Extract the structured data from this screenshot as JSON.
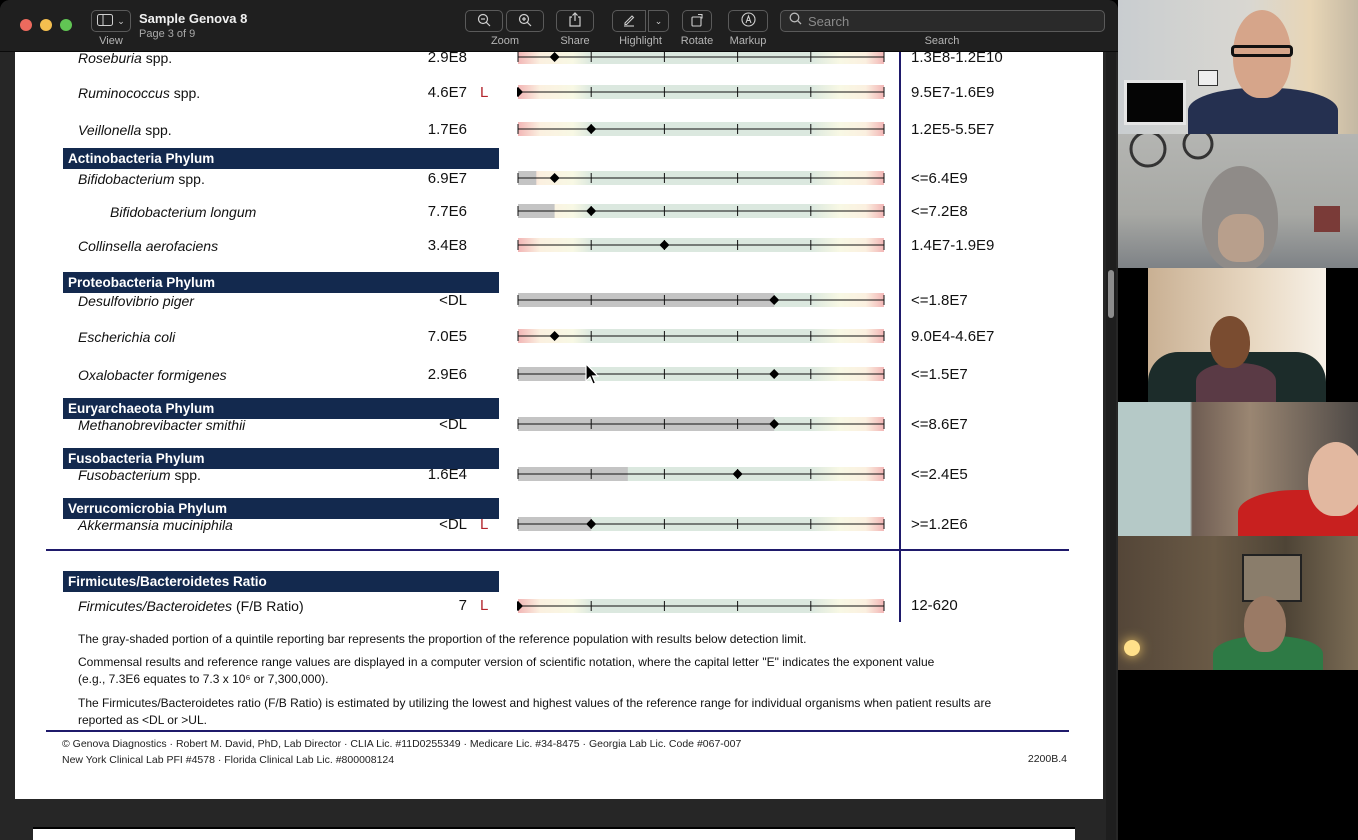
{
  "app": {
    "title": "Sample Genova 8",
    "subtitle": "Page 3 of 9"
  },
  "toolbar": {
    "view_label": "View",
    "zoom_label": "Zoom",
    "share_label": "Share",
    "highlight_label": "Highlight",
    "rotate_label": "Rotate",
    "markup_label": "Markup",
    "search_label": "Search",
    "search_placeholder": "Search"
  },
  "report": {
    "rows": [
      {
        "type": "organism",
        "genus": "Roseburia",
        "suffix": " spp.",
        "result": "2.9E8",
        "flag": "",
        "ref": "1.3E8-1.2E10",
        "marker_quintile": 0.5,
        "gray_fraction": 0
      },
      {
        "type": "organism",
        "genus": "Ruminococcus",
        "suffix": " spp.",
        "result": "4.6E7",
        "flag": "L",
        "ref": "9.5E7-1.6E9",
        "marker_quintile": 0,
        "gray_fraction": 0
      },
      {
        "type": "organism",
        "genus": "Veillonella",
        "suffix": " spp.",
        "result": "1.7E6",
        "flag": "",
        "ref": "1.2E5-5.5E7",
        "marker_quintile": 1,
        "gray_fraction": 0
      },
      {
        "type": "phylum",
        "label": "Actinobacteria Phylum"
      },
      {
        "type": "organism",
        "genus": "Bifidobacterium",
        "suffix": " spp.",
        "result": "6.9E7",
        "flag": "",
        "ref": "<=6.4E9",
        "marker_quintile": 0.5,
        "gray_fraction": 0.05
      },
      {
        "type": "organism",
        "genus": "Bifidobacterium longum",
        "suffix": "",
        "indent": true,
        "result": "7.7E6",
        "flag": "",
        "ref": "<=7.2E8",
        "marker_quintile": 1,
        "gray_fraction": 0.1
      },
      {
        "type": "organism",
        "genus": "Collinsella aerofaciens",
        "suffix": "",
        "result": "3.4E8",
        "flag": "",
        "ref": "1.4E7-1.9E9",
        "marker_quintile": 2,
        "gray_fraction": 0
      },
      {
        "type": "phylum",
        "label": "Proteobacteria Phylum"
      },
      {
        "type": "organism",
        "genus": "Desulfovibrio piger",
        "suffix": "",
        "result": "<DL",
        "flag": "",
        "ref": "<=1.8E7",
        "marker_quintile": 3.5,
        "gray_fraction": 0.7
      },
      {
        "type": "organism",
        "genus": "Escherichia coli",
        "suffix": "",
        "result": "7.0E5",
        "flag": "",
        "ref": "9.0E4-4.6E7",
        "marker_quintile": 0.5,
        "gray_fraction": 0
      },
      {
        "type": "organism",
        "genus": "Oxalobacter formigenes",
        "suffix": "",
        "result": "2.9E6",
        "flag": "",
        "ref": "<=1.5E7",
        "marker_quintile": 3.5,
        "gray_fraction": 0.19
      },
      {
        "type": "phylum",
        "label": "Euryarchaeota Phylum"
      },
      {
        "type": "organism",
        "genus": "Methanobrevibacter smithii",
        "suffix": "",
        "result": "<DL",
        "flag": "",
        "ref": "<=8.6E7",
        "marker_quintile": 3.5,
        "gray_fraction": 0.7
      },
      {
        "type": "phylum",
        "label": "Fusobacteria Phylum"
      },
      {
        "type": "organism",
        "genus": "Fusobacterium",
        "suffix": " spp.",
        "result": "1.6E4",
        "flag": "",
        "ref": "<=2.4E5",
        "marker_quintile": 3,
        "gray_fraction": 0.3
      },
      {
        "type": "phylum",
        "label": "Verrucomicrobia Phylum"
      },
      {
        "type": "organism",
        "genus": "Akkermansia muciniphila",
        "suffix": "",
        "result": "<DL",
        "flag": "L",
        "ref": ">=1.2E6",
        "marker_quintile": 1,
        "gray_fraction": 0.2
      }
    ],
    "ratio_section": {
      "header": "Firmicutes/Bacteroidetes Ratio",
      "genus": "Firmicutes/Bacteroidetes",
      "suffix": " (F/B Ratio)",
      "result": "7",
      "flag": "L",
      "ref": "12-620",
      "marker_quintile": 0
    },
    "notes": [
      "The gray-shaded portion of a quintile reporting bar represents the proportion of the reference population with results below detection limit.",
      "Commensal results and reference range values are displayed in a computer version of scientific notation, where the capital letter \"E\" indicates the exponent value (e.g., 7.3E6 equates to 7.3 x 10⁶ or 7,300,000).",
      "The Firmicutes/Bacteroidetes ratio (F/B Ratio) is estimated by utilizing the lowest and highest values of the reference range for individual organisms when patient results are reported as <DL or >UL."
    ],
    "footer_line1": "© Genova Diagnostics · Robert M. David, PhD, Lab Director · CLIA Lic. #11D0255349 · Medicare Lic. #34-8475 · Georgia Lab Lic. Code #067-007",
    "footer_line2": "New York Clinical Lab PFI #4578 · Florida Clinical Lab Lic. #800008124",
    "form_code": "2200B.4"
  },
  "colors": {
    "phylum_header": "#13294e",
    "flag": "#b3242c",
    "rule": "#1f1a6b"
  },
  "video_participants": [
    {
      "name": "participant-1"
    },
    {
      "name": "participant-2"
    },
    {
      "name": "participant-3"
    },
    {
      "name": "participant-4"
    },
    {
      "name": "participant-5"
    }
  ]
}
